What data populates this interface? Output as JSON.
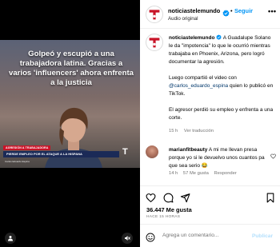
{
  "media": {
    "headline": "Golpeó y escupió a una trabajadora latina. Gracias a varios 'influencers' ahora enfrenta a la justicia",
    "tag": "AGRESIÓN A TRABAJADORA",
    "chyron": "PIERDE EMPLEO POR EL ATAQUE A LA HISPANA",
    "credit": "Carlos Eduardo Espina",
    "logo": "T",
    "icons": {
      "tag": "person-tag-icon",
      "mute": "speaker-muted-icon"
    }
  },
  "header": {
    "username": "noticiastelemundo",
    "dot": "•",
    "follow_label": "Seguir",
    "subtitle": "Audio original",
    "more": "•••"
  },
  "caption": {
    "username": "noticiastelemundo",
    "text1": "A Guadalupe Solano le da \"impotencia\" lo que le ocurrió mientras trabajaba en Phoenix, Arizona, pero logró documentar la agresión.",
    "text2a": "Luego compartió el video con",
    "mention": "@carlos_eduardo_espina",
    "text2b": "quien lo publicó en TikTok.",
    "text3": "El agresor perdió su empleo y enfrenta a una corte.",
    "time": "15 h",
    "translation": "Ver traducción"
  },
  "comment": {
    "username": "marianfitbeauty",
    "text": "A mi me llevan presa porque yo si le devuelvo unos cuantos pa que sea serio 😂",
    "time": "14 h",
    "likes": "57 Me gusta",
    "reply": "Responder"
  },
  "actions": {
    "likes": "36.447 Me gusta",
    "date": "HACE 15 HORAS"
  },
  "composer": {
    "placeholder": "Agrega un comentario...",
    "publish": "Publicar"
  },
  "colors": {
    "accent": "#0095f6",
    "telemundo_red": "#c81428",
    "verified": "#0095f6",
    "muted": "#737373",
    "mention": "#00376b"
  }
}
